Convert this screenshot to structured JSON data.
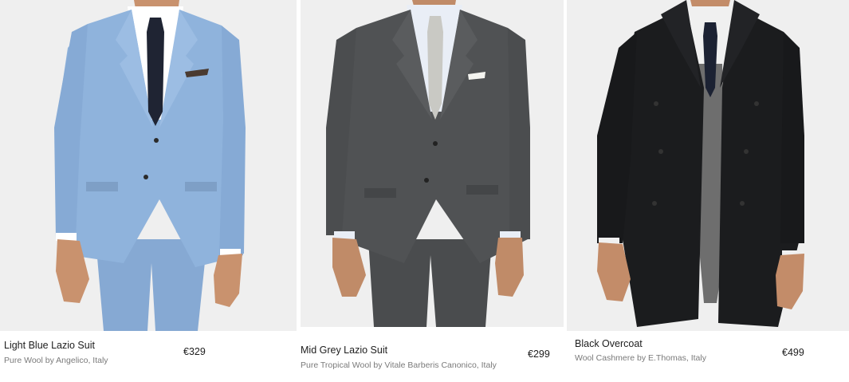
{
  "products": [
    {
      "name": "Light Blue Lazio Suit",
      "description": "Pure Wool by Angelico, Italy",
      "price": "€329",
      "colors": {
        "garment": "#8fb3dc",
        "tie": "#1f2433",
        "shirt": "#ffffff",
        "skin": "#c9926e"
      }
    },
    {
      "name": "Mid Grey Lazio Suit",
      "description": "Pure Tropical Wool by Vitale Barberis Canonico, Italy",
      "price": "€299",
      "colors": {
        "garment": "#505254",
        "tie": "#c9c9c4",
        "shirt": "#e9eef6",
        "skin": "#c08b68"
      }
    },
    {
      "name": "Black Overcoat",
      "description": "Wool Cashmere by E.Thomas, Italy",
      "price": "€499",
      "colors": {
        "garment": "#1b1c1e",
        "tie": "#1c2233",
        "shirt": "#f0f0f0",
        "skin": "#c38c69"
      }
    }
  ]
}
